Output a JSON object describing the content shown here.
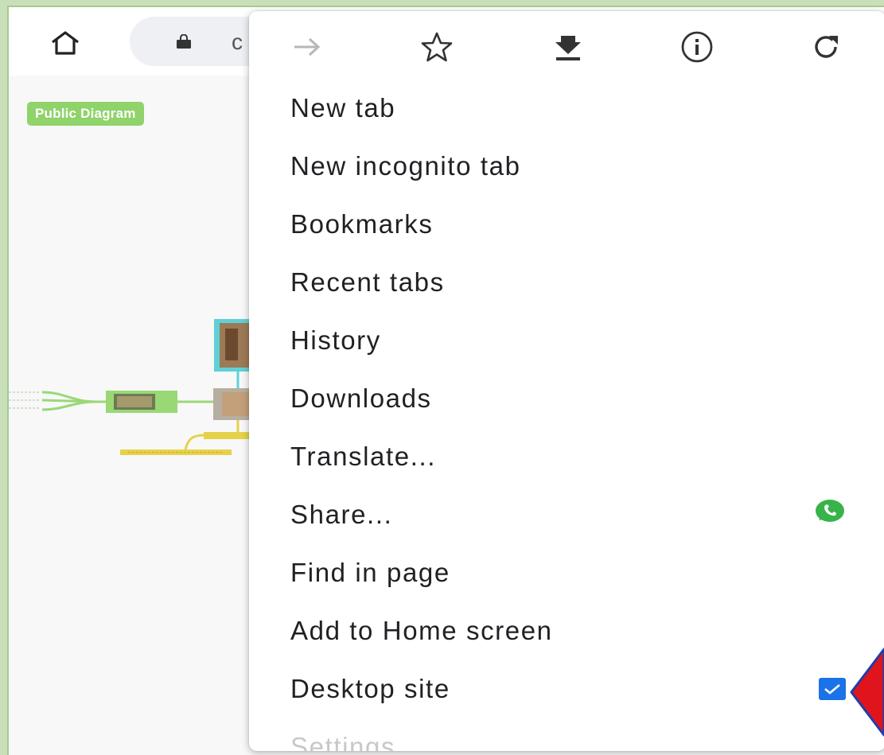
{
  "toolbar": {
    "home_icon": "home-icon",
    "lock_icon": "lock-icon",
    "url_text": "c"
  },
  "page": {
    "badge": "Public Diagram",
    "accent": "#8fd36a"
  },
  "menu": {
    "icons": [
      "forward-icon",
      "star-icon",
      "download-icon",
      "info-icon",
      "refresh-icon"
    ],
    "items": [
      {
        "label": "New tab"
      },
      {
        "label": "New incognito tab"
      },
      {
        "label": "Bookmarks"
      },
      {
        "label": "Recent tabs"
      },
      {
        "label": "History"
      },
      {
        "label": "Downloads"
      },
      {
        "label": "Translate..."
      },
      {
        "label": "Share...",
        "trailing_icon": "whatsapp-icon"
      },
      {
        "label": "Find in page"
      },
      {
        "label": "Add to Home screen"
      },
      {
        "label": "Desktop site",
        "checked": true
      },
      {
        "label": "Settings"
      }
    ]
  },
  "colors": {
    "frame": "#c9dfb9",
    "checkbox": "#1a73e8",
    "pointer": "#e0141c",
    "pointer_outline": "#1f3ea8",
    "whatsapp": "#38b34a"
  }
}
